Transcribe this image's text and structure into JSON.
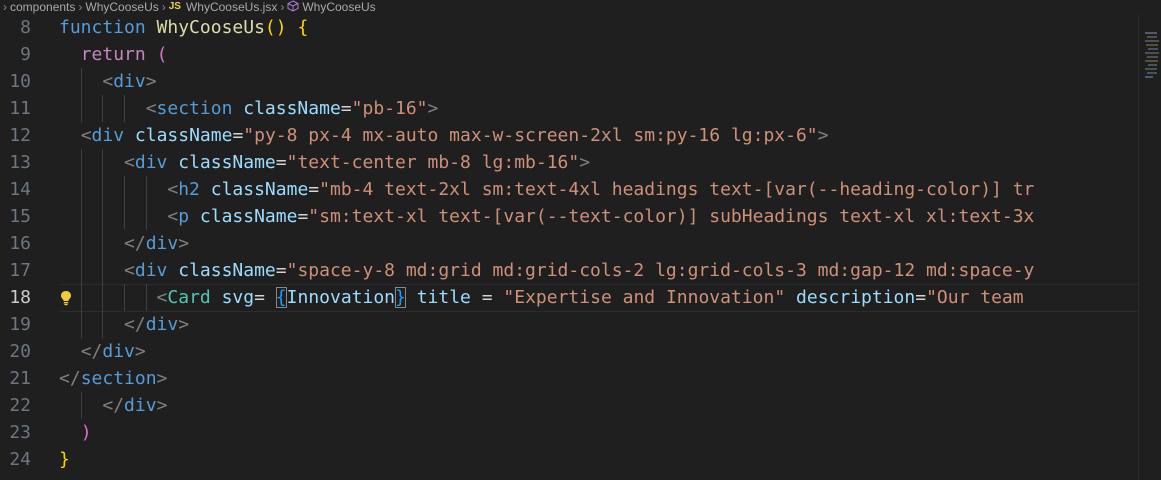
{
  "breadcrumb": {
    "items": [
      "components",
      "WhyCooseUs",
      "WhyCooseUs.jsx",
      "WhyCooseUs"
    ],
    "file_badge": "JS"
  },
  "editor": {
    "current_line": 18,
    "lines": [
      {
        "num": "8",
        "tokens": [
          {
            "t": "function ",
            "c": "kw"
          },
          {
            "t": "WhyCooseUs",
            "c": "fn"
          },
          {
            "t": "()",
            "c": "p1"
          },
          {
            "t": " ",
            "c": "plain"
          },
          {
            "t": "{",
            "c": "p1"
          }
        ]
      },
      {
        "num": "9",
        "tokens": [
          {
            "t": "  ",
            "c": "plain"
          },
          {
            "t": "return",
            "c": "ctl"
          },
          {
            "t": " ",
            "c": "plain"
          },
          {
            "t": "(",
            "c": "p2"
          }
        ]
      },
      {
        "num": "10",
        "tokens": [
          {
            "t": "    ",
            "c": "plain"
          },
          {
            "t": "<",
            "c": "punc"
          },
          {
            "t": "div",
            "c": "tag"
          },
          {
            "t": ">",
            "c": "punc"
          }
        ]
      },
      {
        "num": "11",
        "tokens": [
          {
            "t": "        ",
            "c": "plain"
          },
          {
            "t": "<",
            "c": "punc"
          },
          {
            "t": "section",
            "c": "tag"
          },
          {
            "t": " ",
            "c": "plain"
          },
          {
            "t": "className",
            "c": "attr"
          },
          {
            "t": "=",
            "c": "plain"
          },
          {
            "t": "\"pb-16\"",
            "c": "str"
          },
          {
            "t": ">",
            "c": "punc"
          }
        ]
      },
      {
        "num": "12",
        "tokens": [
          {
            "t": "  ",
            "c": "plain"
          },
          {
            "t": "<",
            "c": "punc"
          },
          {
            "t": "div",
            "c": "tag"
          },
          {
            "t": " ",
            "c": "plain"
          },
          {
            "t": "className",
            "c": "attr"
          },
          {
            "t": "=",
            "c": "plain"
          },
          {
            "t": "\"py-8 px-4 mx-auto max-w-screen-2xl sm:py-16 lg:px-6\"",
            "c": "str"
          },
          {
            "t": ">",
            "c": "punc"
          }
        ]
      },
      {
        "num": "13",
        "tokens": [
          {
            "t": "      ",
            "c": "plain"
          },
          {
            "t": "<",
            "c": "punc"
          },
          {
            "t": "div",
            "c": "tag"
          },
          {
            "t": " ",
            "c": "plain"
          },
          {
            "t": "className",
            "c": "attr"
          },
          {
            "t": "=",
            "c": "plain"
          },
          {
            "t": "\"text-center mb-8 lg:mb-16\"",
            "c": "str"
          },
          {
            "t": ">",
            "c": "punc"
          }
        ]
      },
      {
        "num": "14",
        "tokens": [
          {
            "t": "          ",
            "c": "plain"
          },
          {
            "t": "<",
            "c": "punc"
          },
          {
            "t": "h2",
            "c": "tag"
          },
          {
            "t": " ",
            "c": "plain"
          },
          {
            "t": "className",
            "c": "attr"
          },
          {
            "t": "=",
            "c": "plain"
          },
          {
            "t": "\"mb-4 text-2xl sm:text-4xl headings text-[var(--heading-color)] tr",
            "c": "str"
          }
        ]
      },
      {
        "num": "15",
        "tokens": [
          {
            "t": "          ",
            "c": "plain"
          },
          {
            "t": "<",
            "c": "punc"
          },
          {
            "t": "p",
            "c": "tag"
          },
          {
            "t": " ",
            "c": "plain"
          },
          {
            "t": "className",
            "c": "attr"
          },
          {
            "t": "=",
            "c": "plain"
          },
          {
            "t": "\"sm:text-xl text-[var(--text-color)] subHeadings text-xl xl:text-3x",
            "c": "str"
          }
        ]
      },
      {
        "num": "16",
        "tokens": [
          {
            "t": "      ",
            "c": "plain"
          },
          {
            "t": "</",
            "c": "punc"
          },
          {
            "t": "div",
            "c": "tag"
          },
          {
            "t": ">",
            "c": "punc"
          }
        ]
      },
      {
        "num": "17",
        "tokens": [
          {
            "t": "      ",
            "c": "plain"
          },
          {
            "t": "<",
            "c": "punc"
          },
          {
            "t": "div",
            "c": "tag"
          },
          {
            "t": " ",
            "c": "plain"
          },
          {
            "t": "className",
            "c": "attr"
          },
          {
            "t": "=",
            "c": "plain"
          },
          {
            "t": "\"space-y-8 md:grid md:grid-cols-2 lg:grid-cols-3 md:gap-12 md:space-y",
            "c": "str"
          }
        ]
      },
      {
        "num": "18",
        "tokens": [
          {
            "t": "         ",
            "c": "plain"
          },
          {
            "t": "<",
            "c": "punc"
          },
          {
            "t": "Card",
            "c": "comp"
          },
          {
            "t": " ",
            "c": "plain"
          },
          {
            "t": "svg",
            "c": "attr"
          },
          {
            "t": "= ",
            "c": "plain"
          },
          {
            "t": "{",
            "c": "p3",
            "box": true
          },
          {
            "t": "Innovation",
            "c": "var"
          },
          {
            "t": "}",
            "c": "p3",
            "box": true
          },
          {
            "t": " ",
            "c": "plain"
          },
          {
            "t": "title",
            "c": "attr"
          },
          {
            "t": " = ",
            "c": "plain"
          },
          {
            "t": "\"Expertise and Innovation\"",
            "c": "str"
          },
          {
            "t": " ",
            "c": "plain"
          },
          {
            "t": "description",
            "c": "attr"
          },
          {
            "t": "=",
            "c": "plain"
          },
          {
            "t": "\"Our team ",
            "c": "str"
          }
        ]
      },
      {
        "num": "19",
        "tokens": [
          {
            "t": "      ",
            "c": "plain"
          },
          {
            "t": "</",
            "c": "punc"
          },
          {
            "t": "div",
            "c": "tag"
          },
          {
            "t": ">",
            "c": "punc"
          }
        ]
      },
      {
        "num": "20",
        "tokens": [
          {
            "t": "  ",
            "c": "plain"
          },
          {
            "t": "</",
            "c": "punc"
          },
          {
            "t": "div",
            "c": "tag"
          },
          {
            "t": ">",
            "c": "punc"
          }
        ]
      },
      {
        "num": "21",
        "tokens": [
          {
            "t": "</",
            "c": "punc"
          },
          {
            "t": "section",
            "c": "tag"
          },
          {
            "t": ">",
            "c": "punc"
          }
        ]
      },
      {
        "num": "22",
        "tokens": [
          {
            "t": "    ",
            "c": "plain"
          },
          {
            "t": "</",
            "c": "punc"
          },
          {
            "t": "div",
            "c": "tag"
          },
          {
            "t": ">",
            "c": "punc"
          }
        ]
      },
      {
        "num": "23",
        "tokens": [
          {
            "t": "  ",
            "c": "plain"
          },
          {
            "t": ")",
            "c": "p2"
          }
        ]
      },
      {
        "num": "24",
        "tokens": [
          {
            "t": "}",
            "c": "p1"
          }
        ]
      }
    ]
  },
  "icons": {
    "breadcrumb_separator": "chevron-right-icon",
    "symbol": "cube-icon",
    "code_action": "lightbulb-icon"
  },
  "colors": {
    "background": "#1f1f1f",
    "keyword": "#569cd6",
    "string": "#ce9178",
    "attribute": "#9cdcfe",
    "component": "#4ec9b0",
    "lightbulb": "#f2cc37"
  }
}
